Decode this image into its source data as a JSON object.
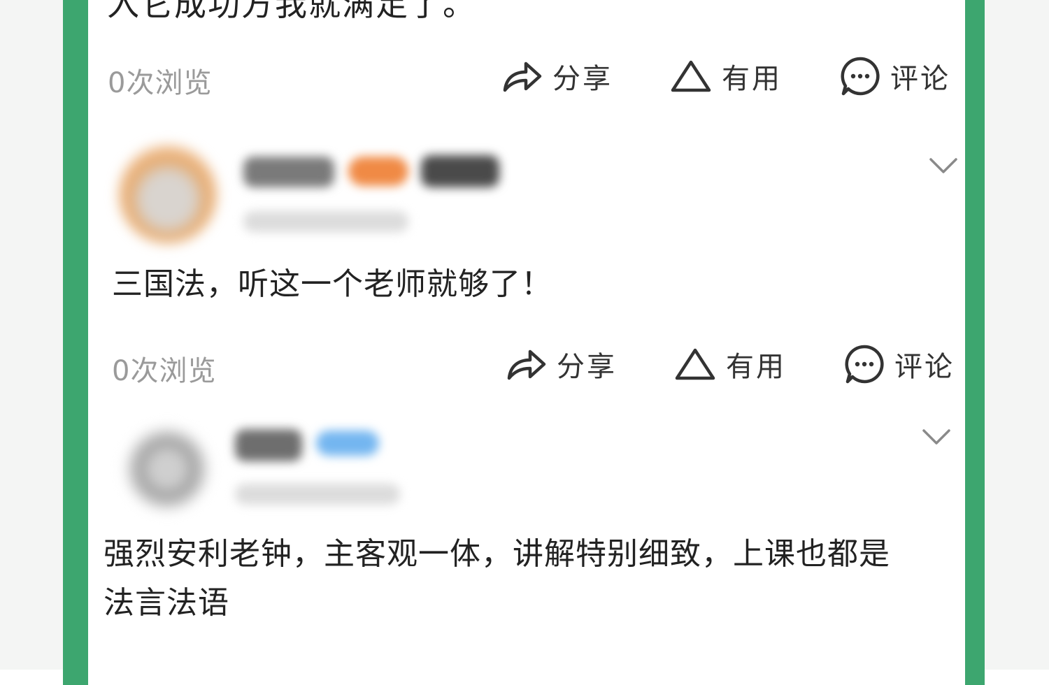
{
  "top": {
    "partial_text": "入它成功方我就满足了。"
  },
  "actions": {
    "views": "0次浏览",
    "share": "分享",
    "useful": "有用",
    "comment": "评论"
  },
  "comments": [
    {
      "text": "三国法，听这一个老师就够了！"
    },
    {
      "text_line1": "强烈安利老钟，主客观一体，讲解特别细致，上课也都是",
      "text_line2": "法言法语"
    }
  ],
  "colors": {
    "frame_green": "#3da66f",
    "text": "#222222",
    "muted": "#9a9a9a"
  },
  "icons": [
    "share-icon",
    "useful-triangle-icon",
    "comment-bubble-icon",
    "chevron-down-icon"
  ]
}
